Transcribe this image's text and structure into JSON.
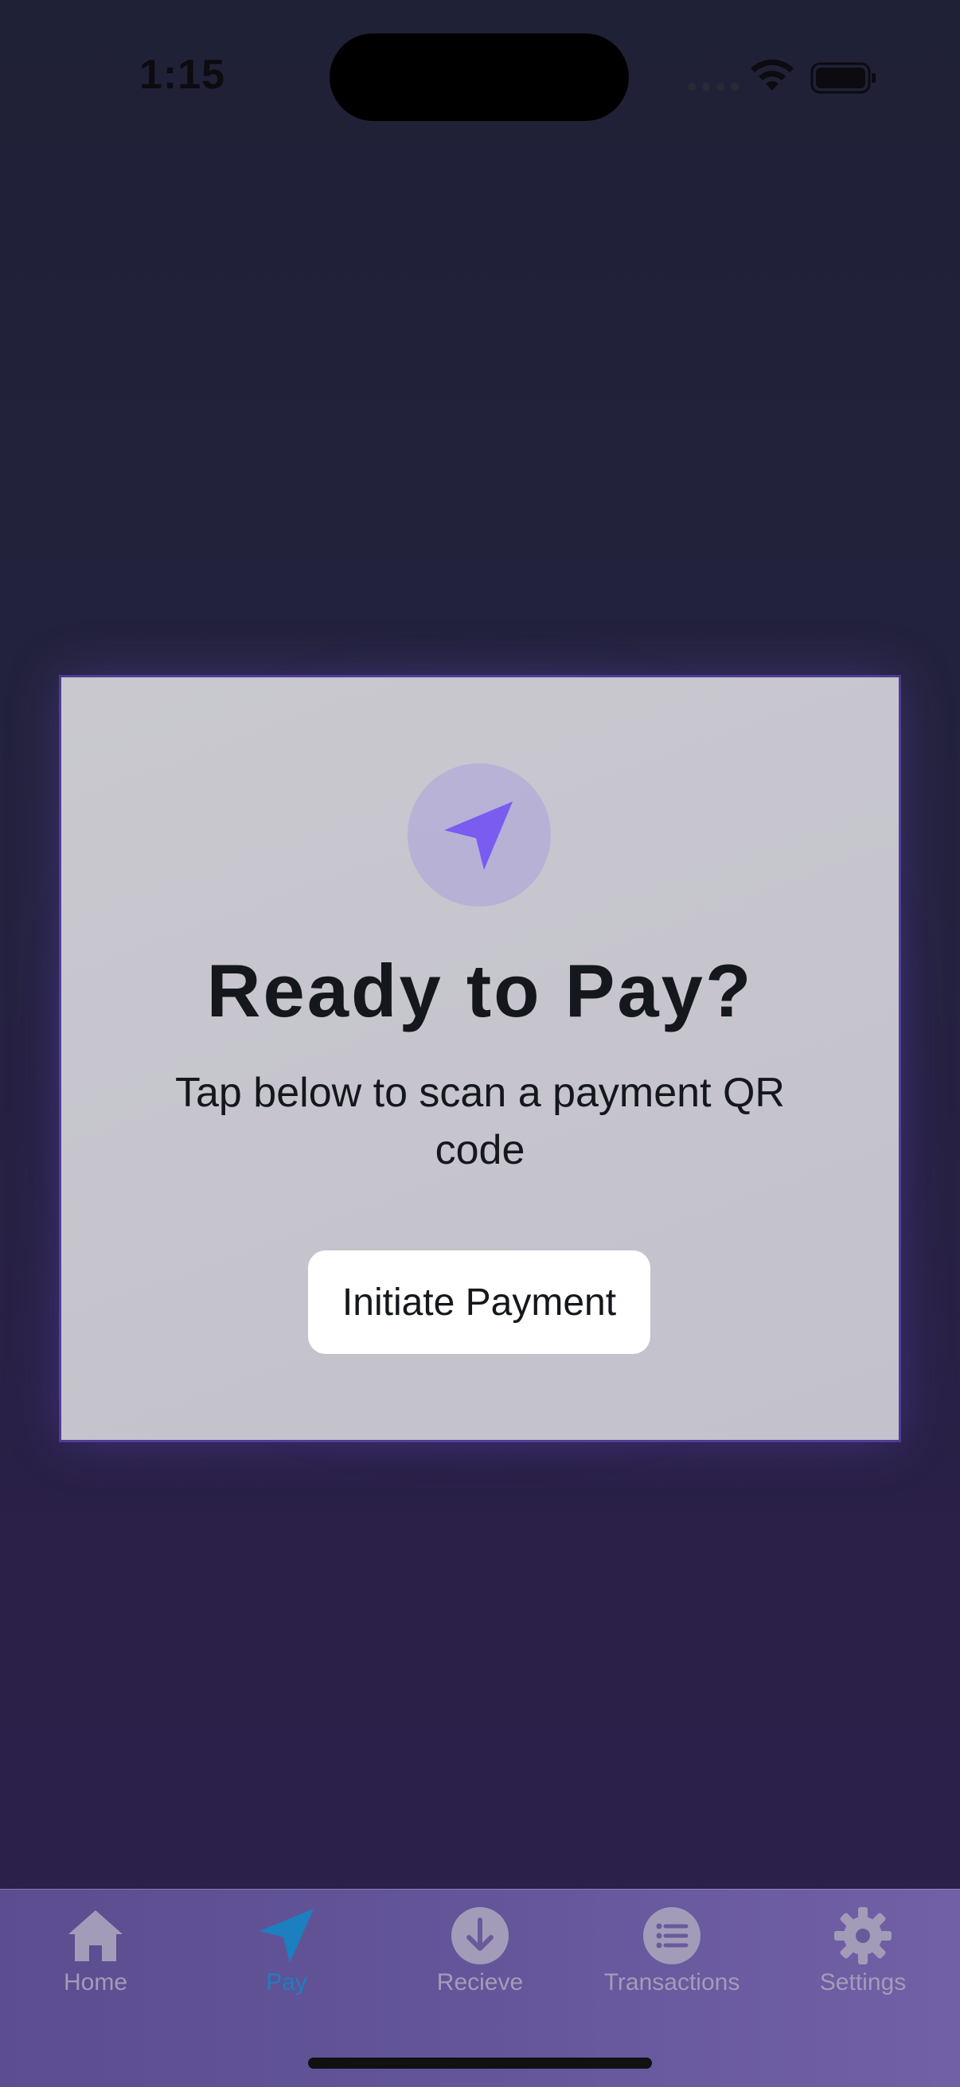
{
  "status_bar": {
    "time": "1:15",
    "icons": [
      "cellular-signal-icon",
      "wifi-icon",
      "battery-icon"
    ]
  },
  "pay_card": {
    "icon": "paper-plane-icon",
    "title": "Ready to Pay?",
    "subtitle": "Tap below to scan a payment QR code",
    "button_label": "Initiate Payment"
  },
  "tab_bar": {
    "items": [
      {
        "label": "Home",
        "icon": "home-icon",
        "active": false
      },
      {
        "label": "Pay",
        "icon": "paper-plane-icon",
        "active": true
      },
      {
        "label": "Recieve",
        "icon": "arrow-down-circle-icon",
        "active": false
      },
      {
        "label": "Transactions",
        "icon": "list-circle-icon",
        "active": false
      },
      {
        "label": "Settings",
        "icon": "gear-icon",
        "active": false
      }
    ]
  },
  "colors": {
    "accent": "#7a5cf0",
    "active_tab": "#1c7fc0",
    "inactive_tab": "#a39cb8",
    "card_background": "#c7c6ce",
    "background": "#24223e"
  }
}
